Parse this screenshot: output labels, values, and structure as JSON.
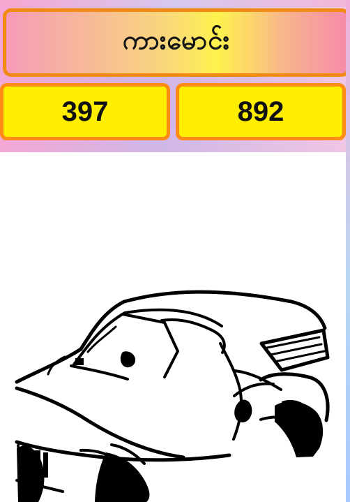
{
  "header": {
    "title": "ကားမောင်း"
  },
  "numbers": {
    "left": "397",
    "right": "892"
  },
  "image": {
    "name": "car-illustration"
  }
}
